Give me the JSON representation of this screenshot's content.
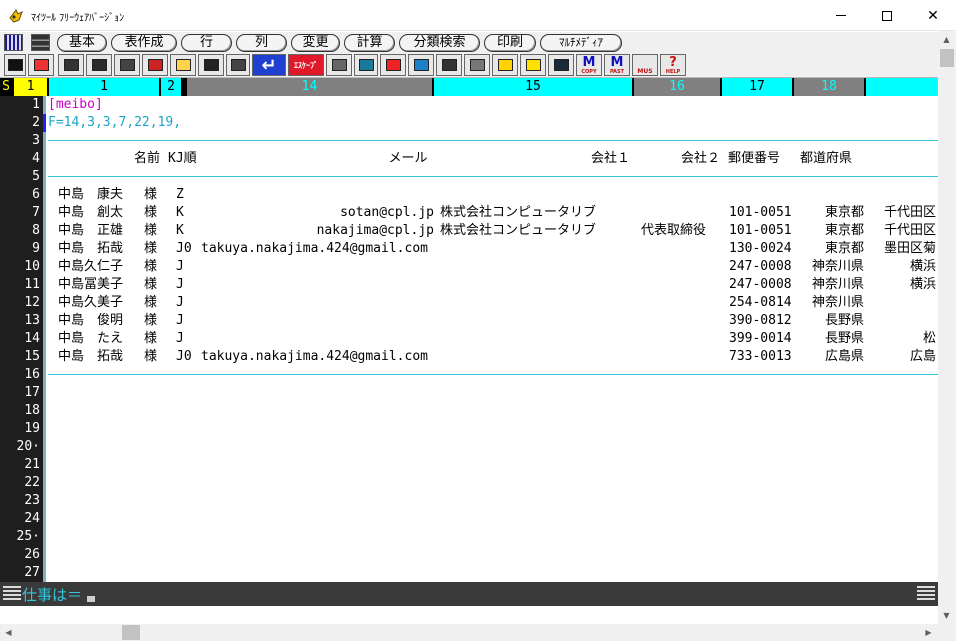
{
  "window": {
    "title": "ﾏｲﾂｰﾙ ﾌﾘｰｳｪｱﾊﾞｰｼﾞｮﾝ",
    "minimize_glyph": "—",
    "close_glyph": "✕"
  },
  "menu": {
    "items": [
      "基本",
      "表作成",
      "行",
      "列",
      "変更",
      "計算",
      "分類検索",
      "印刷",
      "ﾏﾙﾁﾒﾃﾞｨｱ"
    ]
  },
  "toolbar": {
    "buttons": [
      {
        "name": "grid-icon",
        "text": ""
      },
      {
        "name": "color-icon",
        "text": ""
      },
      {
        "name": "keyboard-icon",
        "text": ""
      },
      {
        "name": "window-icon",
        "text": ""
      },
      {
        "name": "cards-icon",
        "text": ""
      },
      {
        "name": "printer-red-icon",
        "text": ""
      },
      {
        "name": "floppy-icon",
        "text": ""
      },
      {
        "name": "printer-icon",
        "text": ""
      },
      {
        "name": "no-print-icon",
        "text": ""
      },
      {
        "name": "enter-icon",
        "text": "↵"
      },
      {
        "name": "escape-icon",
        "text": "ｴｽｹｰﾌﾟ"
      },
      {
        "name": "eraser-icon",
        "text": ""
      },
      {
        "name": "table-icon",
        "text": ""
      },
      {
        "name": "insert-icon",
        "text": ""
      },
      {
        "name": "copy-box-icon",
        "text": ""
      },
      {
        "name": "pencil-icon",
        "text": ""
      },
      {
        "name": "speaker-icon",
        "text": ""
      },
      {
        "name": "book-icon",
        "text": ""
      },
      {
        "name": "notebook-icon",
        "text": ""
      },
      {
        "name": "screen-icon",
        "text": ""
      },
      {
        "name": "m-copy-icon",
        "text": "M"
      },
      {
        "name": "m-past-icon",
        "text": "M"
      },
      {
        "name": "mus-icon",
        "text": "MUS"
      },
      {
        "name": "help-icon",
        "text": "?"
      }
    ],
    "sub_labels": {
      "copy": "COPY",
      "past": "PAST",
      "help": "HELP"
    }
  },
  "ruler": {
    "segments": [
      {
        "label": "S",
        "bg": "#000000",
        "fg": "#ffff00"
      },
      {
        "label": "1",
        "bg": "#ffff00",
        "fg": "#000000"
      },
      {
        "label": "1",
        "bg": "#00ffff",
        "fg": "#000000"
      },
      {
        "label": "2",
        "bg": "#808080",
        "fg": "#00ffff"
      },
      {
        "label": "14",
        "bg": "#808080",
        "fg": "#00ffff"
      },
      {
        "label": "15",
        "bg": "#00ffff",
        "fg": "#000000"
      },
      {
        "label": "16",
        "bg": "#808080",
        "fg": "#00ffff"
      },
      {
        "label": "17",
        "bg": "#00ffff",
        "fg": "#000000"
      },
      {
        "label": "18",
        "bg": "#808080",
        "fg": "#00ffff"
      },
      {
        "label": "",
        "bg": "#00ffff",
        "fg": "#000000"
      }
    ]
  },
  "editor": {
    "line_numbers": [
      "1",
      "2",
      "3",
      "4",
      "5",
      "6",
      "7",
      "8",
      "9",
      "10",
      "11",
      "12",
      "13",
      "14",
      "15",
      "16",
      "17",
      "18",
      "19",
      "20·",
      "21",
      "22",
      "23",
      "24",
      "25·",
      "26",
      "27"
    ],
    "tag_line": "[meibo]",
    "format_line": "F=14,3,3,7,22,19,",
    "header": {
      "name": "名前",
      "honorific": "",
      "kj": "KJ順",
      "email": "メール",
      "company1": "会社１",
      "company2": "会社２",
      "postal": "郵便番号",
      "prefecture": "都道府県"
    },
    "rows": [
      {
        "name": "中島　康夫",
        "honorific": "様",
        "kj": "Z",
        "email": "",
        "company1": "",
        "company2": "",
        "postal": "",
        "prefecture": "",
        "city": ""
      },
      {
        "name": "中島　創太",
        "honorific": "様",
        "kj": "K",
        "email": "sotan@cpl.jp",
        "company1": "株式会社コンピュータリブ",
        "company2": "",
        "postal": "101-0051",
        "prefecture": "東京都",
        "city": "千代田区"
      },
      {
        "name": "中島　正雄",
        "honorific": "様",
        "kj": "K",
        "email": "nakajima@cpl.jp",
        "company1": "株式会社コンピュータリブ",
        "company2": "代表取締役",
        "postal": "101-0051",
        "prefecture": "東京都",
        "city": "千代田区"
      },
      {
        "name": "中島　拓哉",
        "honorific": "様",
        "kj": "J0",
        "email": "takuya.nakajima.424@gmail.com",
        "company1": "",
        "company2": "",
        "postal": "130-0024",
        "prefecture": "東京都",
        "city": "墨田区菊"
      },
      {
        "name": "中島久仁子",
        "honorific": "様",
        "kj": "J",
        "email": "",
        "company1": "",
        "company2": "",
        "postal": "247-0008",
        "prefecture": "神奈川県",
        "city": "横浜"
      },
      {
        "name": "中島冨美子",
        "honorific": "様",
        "kj": "J",
        "email": "",
        "company1": "",
        "company2": "",
        "postal": "247-0008",
        "prefecture": "神奈川県",
        "city": "横浜"
      },
      {
        "name": "中島久美子",
        "honorific": "様",
        "kj": "J",
        "email": "",
        "company1": "",
        "company2": "",
        "postal": "254-0814",
        "prefecture": "神奈川県",
        "city": ""
      },
      {
        "name": "中島　俊明",
        "honorific": "様",
        "kj": "J",
        "email": "",
        "company1": "",
        "company2": "",
        "postal": "390-0812",
        "prefecture": "長野県",
        "city": ""
      },
      {
        "name": "中島　たえ",
        "honorific": "様",
        "kj": "J",
        "email": "",
        "company1": "",
        "company2": "",
        "postal": "399-0014",
        "prefecture": "長野県",
        "city": "松"
      },
      {
        "name": "中島　拓哉",
        "honorific": "様",
        "kj": "J0",
        "email": "takuya.nakajima.424@gmail.com",
        "company1": "",
        "company2": "",
        "postal": "733-0013",
        "prefecture": "広島県",
        "city": "広島"
      }
    ]
  },
  "command": {
    "prompt": "仕事は＝"
  },
  "scroll": {
    "up": "▲",
    "down": "▼",
    "left": "◀",
    "right": "▶"
  }
}
